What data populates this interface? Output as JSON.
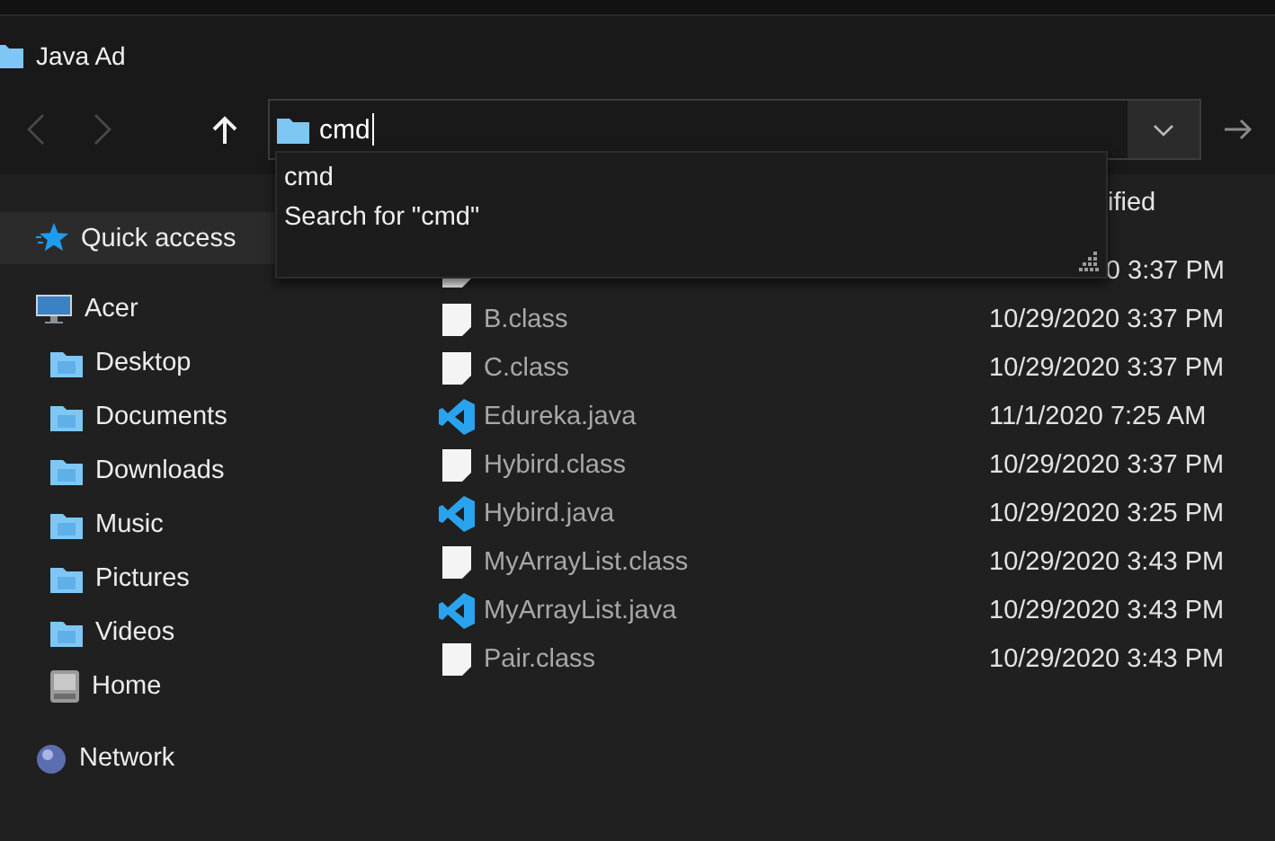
{
  "window": {
    "title": "Java Ad"
  },
  "nav": [
    {
      "kind": "back",
      "disabled": true
    },
    {
      "kind": "forward",
      "disabled": true
    },
    {
      "kind": "up",
      "disabled": false
    }
  ],
  "address_bar": {
    "value": "cmd"
  },
  "suggestions": [
    {
      "label": "cmd"
    },
    {
      "label": "Search for \"cmd\""
    }
  ],
  "table": {
    "columns": [
      {
        "label": "ified"
      }
    ],
    "rows": [
      {
        "kind": "class",
        "date": "0 3:37 PM",
        "clipped": true
      },
      {
        "name": "B.class",
        "kind": "class",
        "date": "10/29/2020 3:37 PM",
        "clipped": false
      },
      {
        "name": "C.class",
        "kind": "class",
        "date": "10/29/2020 3:37 PM",
        "clipped": false
      },
      {
        "name": "Edureka.java",
        "kind": "java",
        "date": "11/1/2020 7:25 AM",
        "clipped": false
      },
      {
        "name": "Hybird.class",
        "kind": "class",
        "date": "10/29/2020 3:37 PM",
        "clipped": false
      },
      {
        "name": "Hybird.java",
        "kind": "java",
        "date": "10/29/2020 3:25 PM",
        "clipped": false
      },
      {
        "name": "MyArrayList.class",
        "kind": "class",
        "date": "10/29/2020 3:43 PM",
        "clipped": false
      },
      {
        "name": "MyArrayList.java",
        "kind": "java",
        "date": "10/29/2020 3:43 PM",
        "clipped": false
      },
      {
        "name": "Pair.class",
        "kind": "class",
        "date": "10/29/2020 3:43 PM",
        "clipped": false
      }
    ]
  },
  "sidebar": {
    "items": [
      {
        "label": "Quick access",
        "kind": "star",
        "selected": true
      },
      {
        "label": "Acer",
        "kind": "computer",
        "selected": false,
        "children": [
          {
            "label": "Desktop",
            "kind": "folder",
            "selected": false
          },
          {
            "label": "Documents",
            "kind": "folder",
            "selected": false
          },
          {
            "label": "Downloads",
            "kind": "folder",
            "selected": false
          },
          {
            "label": "Music",
            "kind": "folder",
            "selected": false
          },
          {
            "label": "Pictures",
            "kind": "folder",
            "selected": false
          },
          {
            "label": "Videos",
            "kind": "folder",
            "selected": false
          },
          {
            "label": "Home",
            "kind": "drive",
            "selected": false
          }
        ]
      },
      {
        "label": "Network",
        "kind": "network",
        "selected": false
      }
    ]
  }
}
